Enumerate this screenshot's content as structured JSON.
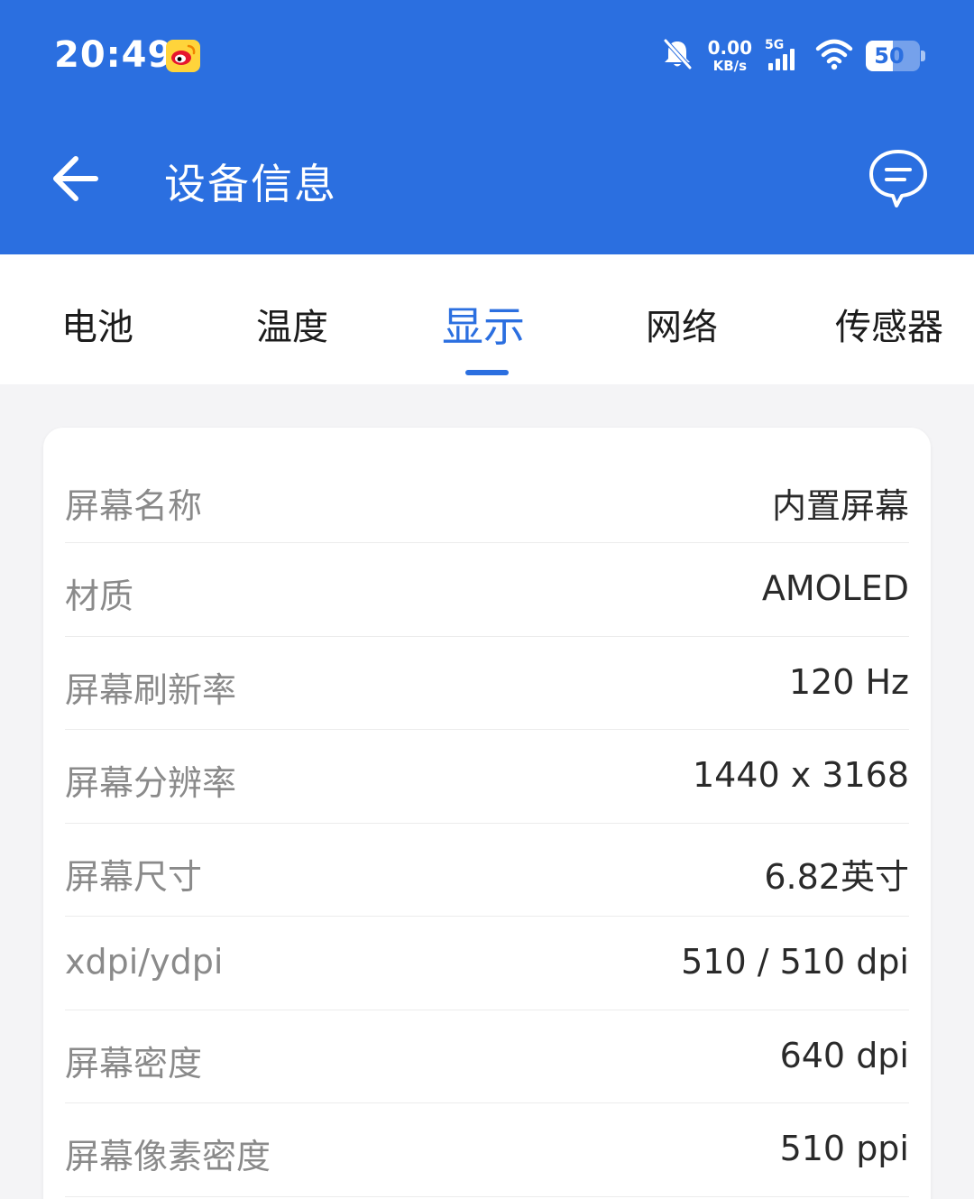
{
  "status_bar": {
    "time": "20:49",
    "app_icon": "weibo-icon",
    "net_speed_value": "0.00",
    "net_speed_unit": "KB/s",
    "network_type": "5G",
    "battery_level": "50",
    "icons": [
      "bell-off-icon",
      "signal-icon",
      "wifi-icon",
      "battery-icon"
    ]
  },
  "toolbar": {
    "title": "设备信息",
    "back_icon": "arrow-left-icon",
    "chat_icon": "chat-bubble-icon"
  },
  "tabs": [
    {
      "label": "电池",
      "active": false
    },
    {
      "label": "温度",
      "active": false
    },
    {
      "label": "显示",
      "active": true
    },
    {
      "label": "网络",
      "active": false
    },
    {
      "label": "传感器",
      "active": false
    }
  ],
  "display_info": [
    {
      "label": "屏幕名称",
      "value": "内置屏幕"
    },
    {
      "label": "材质",
      "value": "AMOLED"
    },
    {
      "label": "屏幕刷新率",
      "value": "120 Hz"
    },
    {
      "label": "屏幕分辨率",
      "value": "1440 x 3168"
    },
    {
      "label": "屏幕尺寸",
      "value": "6.82英寸"
    },
    {
      "label": "xdpi/ydpi",
      "value": "510 / 510 dpi"
    },
    {
      "label": "屏幕密度",
      "value": "640 dpi"
    },
    {
      "label": "屏幕像素密度",
      "value": "510 ppi"
    }
  ],
  "colors": {
    "primary": "#2b6fe0",
    "background": "#f4f4f6",
    "card": "#ffffff",
    "label_text": "#8a8a8a",
    "value_text": "#2a2a2a"
  }
}
